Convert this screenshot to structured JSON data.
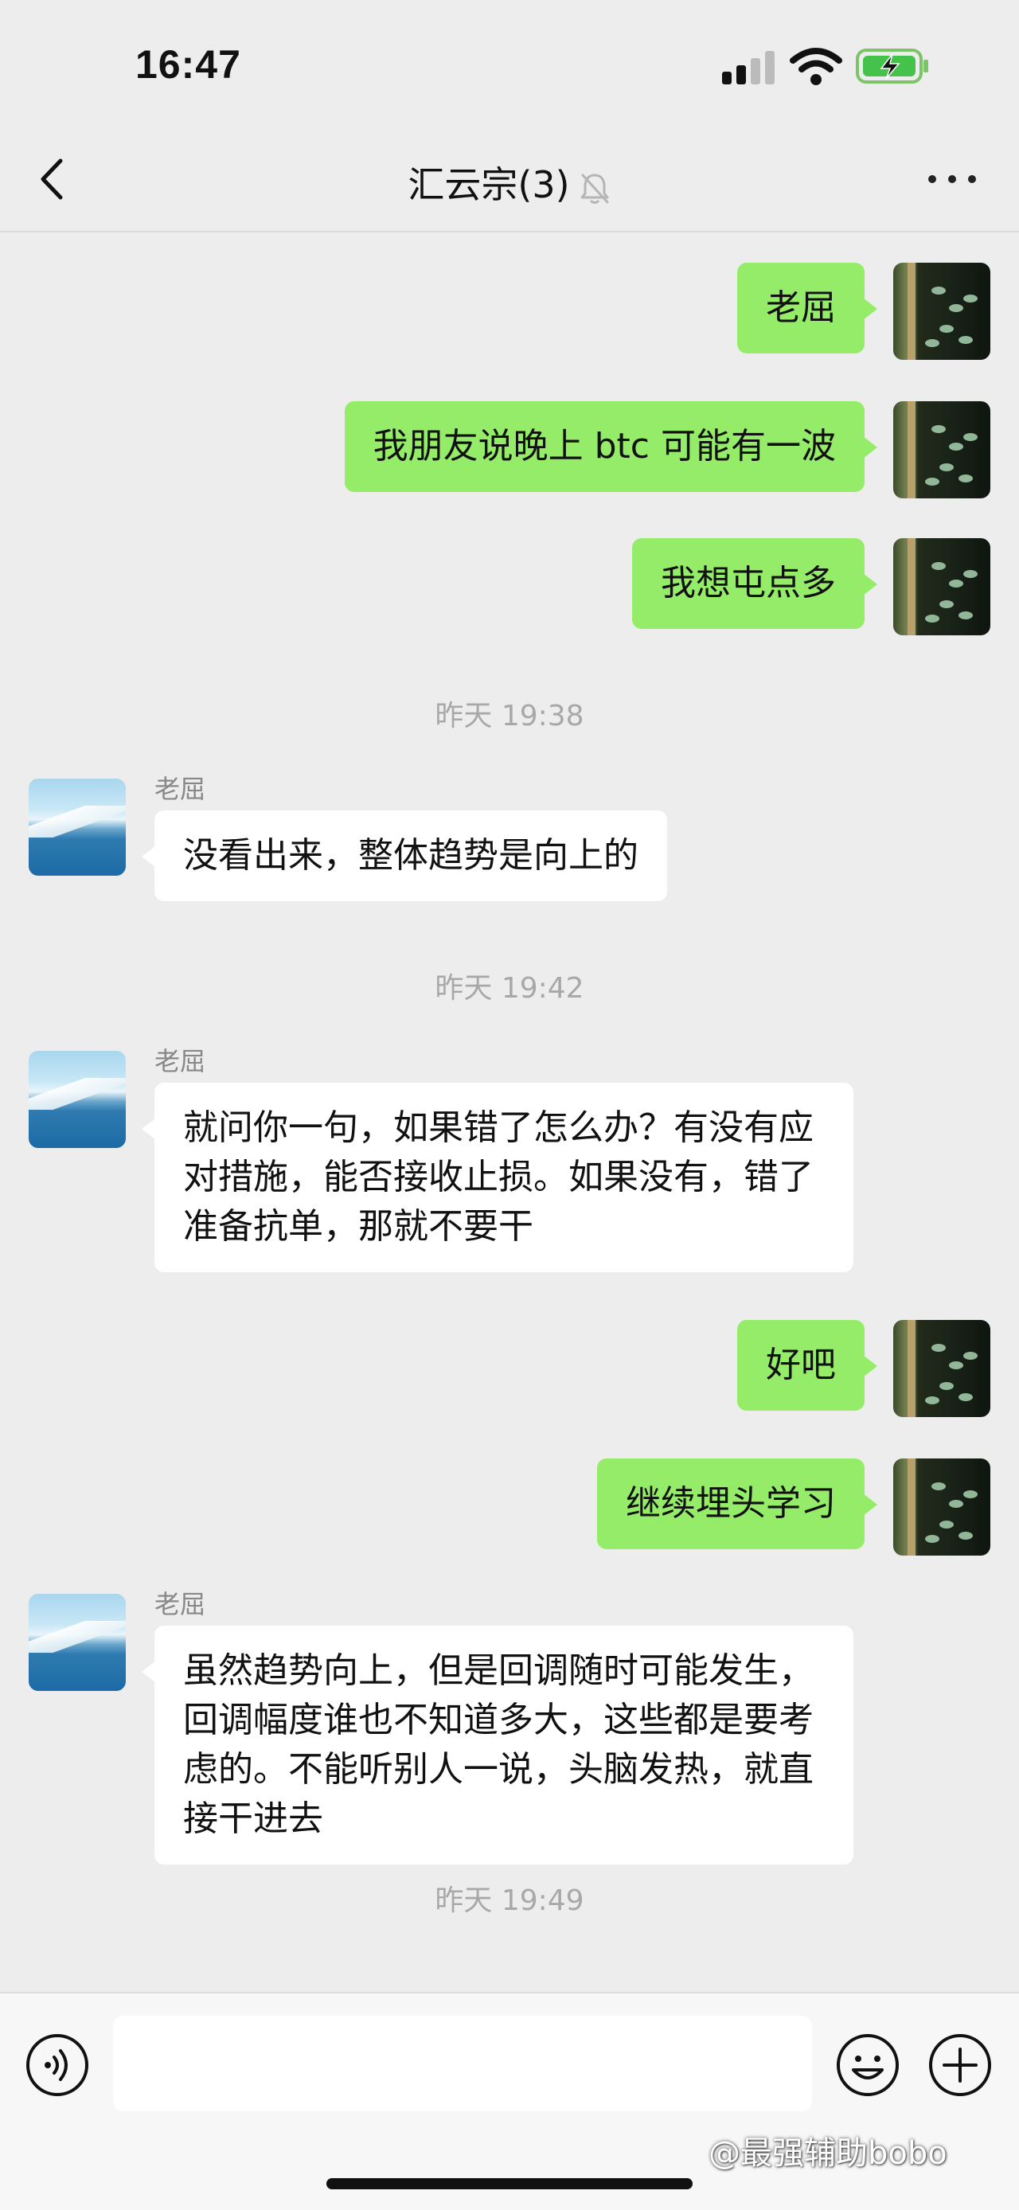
{
  "status_bar": {
    "time": "16:47",
    "icons": [
      "signal-icon",
      "wifi-icon",
      "battery-charging-icon"
    ]
  },
  "nav": {
    "title": "汇云宗(3)",
    "icons": [
      "back-chevron-icon",
      "mute-bell-icon",
      "more-dots-icon"
    ]
  },
  "messages": [
    {
      "type": "text",
      "side": "me",
      "text": "老屈"
    },
    {
      "type": "text",
      "side": "me",
      "text": "我朋友说晚上 btc 可能有一波"
    },
    {
      "type": "text",
      "side": "me",
      "text": "我想屯点多"
    },
    {
      "type": "time",
      "text": "昨天 19:38"
    },
    {
      "type": "text",
      "side": "them",
      "sender": "老屈",
      "text": "没看出来，整体趋势是向上的"
    },
    {
      "type": "time",
      "text": "昨天 19:42"
    },
    {
      "type": "text",
      "side": "them",
      "sender": "老屈",
      "text": "就问你一句，如果错了怎么办？有没有应对措施，能否接收止损。如果没有，错了准备抗单，那就不要干"
    },
    {
      "type": "text",
      "side": "me",
      "text": "好吧"
    },
    {
      "type": "text",
      "side": "me",
      "text": "继续埋头学习"
    },
    {
      "type": "text",
      "side": "them",
      "sender": "老屈",
      "text": "虽然趋势向上，但是回调随时可能发生，回调幅度谁也不知道多大，这些都是要考虑的。不能听别人一说，头脑发热，就直接干进去"
    },
    {
      "type": "time",
      "text": "昨天 19:49"
    }
  ],
  "input_bar": {
    "value": "",
    "icons": [
      "voice-icon",
      "emoji-icon",
      "plus-icon"
    ]
  },
  "watermark": "@最强辅助bobo",
  "colors": {
    "background": "#ededed",
    "my_bubble": "#95ec69",
    "their_bubble": "#ffffff",
    "timestamp": "#a8a8a8"
  }
}
